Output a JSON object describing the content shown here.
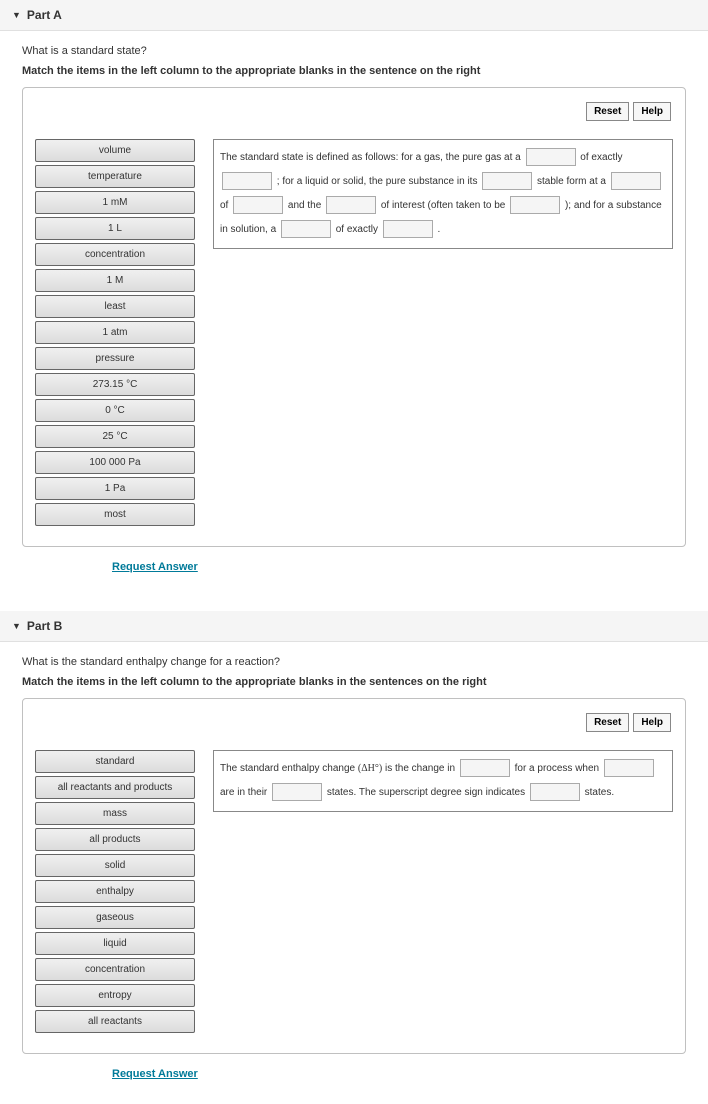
{
  "buttons": {
    "reset": "Reset",
    "help": "Help"
  },
  "request": "Request Answer",
  "partA": {
    "title": "Part A",
    "question": "What is a standard state?",
    "instruction": "Match the items in the left column to the appropriate blanks in the sentence on the right",
    "items": [
      "volume",
      "temperature",
      "1 mM",
      "1 L",
      "concentration",
      "1 M",
      "least",
      "1 atm",
      "pressure",
      "273.15 °C",
      "0 °C",
      "25 °C",
      "100 000 Pa",
      "1 Pa",
      "most"
    ],
    "s": {
      "t1": "The standard state is defined as follows: for a gas, the pure gas at a",
      "t2": "of exactly",
      "t3": "; for a liquid or solid, the pure substance in its",
      "t4": "stable form at a",
      "t5": "of",
      "t6": "and the",
      "t7": "of interest (often taken to be",
      "t8": ");",
      "t9": "and for a substance in solution, a",
      "t10": "of exactly",
      "t11": "."
    }
  },
  "partB": {
    "title": "Part B",
    "question": "What is the standard enthalpy change for a reaction?",
    "instruction": "Match the items in the left column to the appropriate blanks in the sentences on the right",
    "items": [
      "standard",
      "all reactants and products",
      "mass",
      "all products",
      "solid",
      "enthalpy",
      "gaseous",
      "liquid",
      "concentration",
      "entropy",
      "all reactants"
    ],
    "s": {
      "t1": "The standard enthalpy change",
      "formula": "(ΔH°)",
      "t2": "is the change in",
      "t3": "for a process when",
      "t4": "are in their",
      "t5": "states. The superscript degree sign indicates",
      "t6": "states."
    }
  }
}
